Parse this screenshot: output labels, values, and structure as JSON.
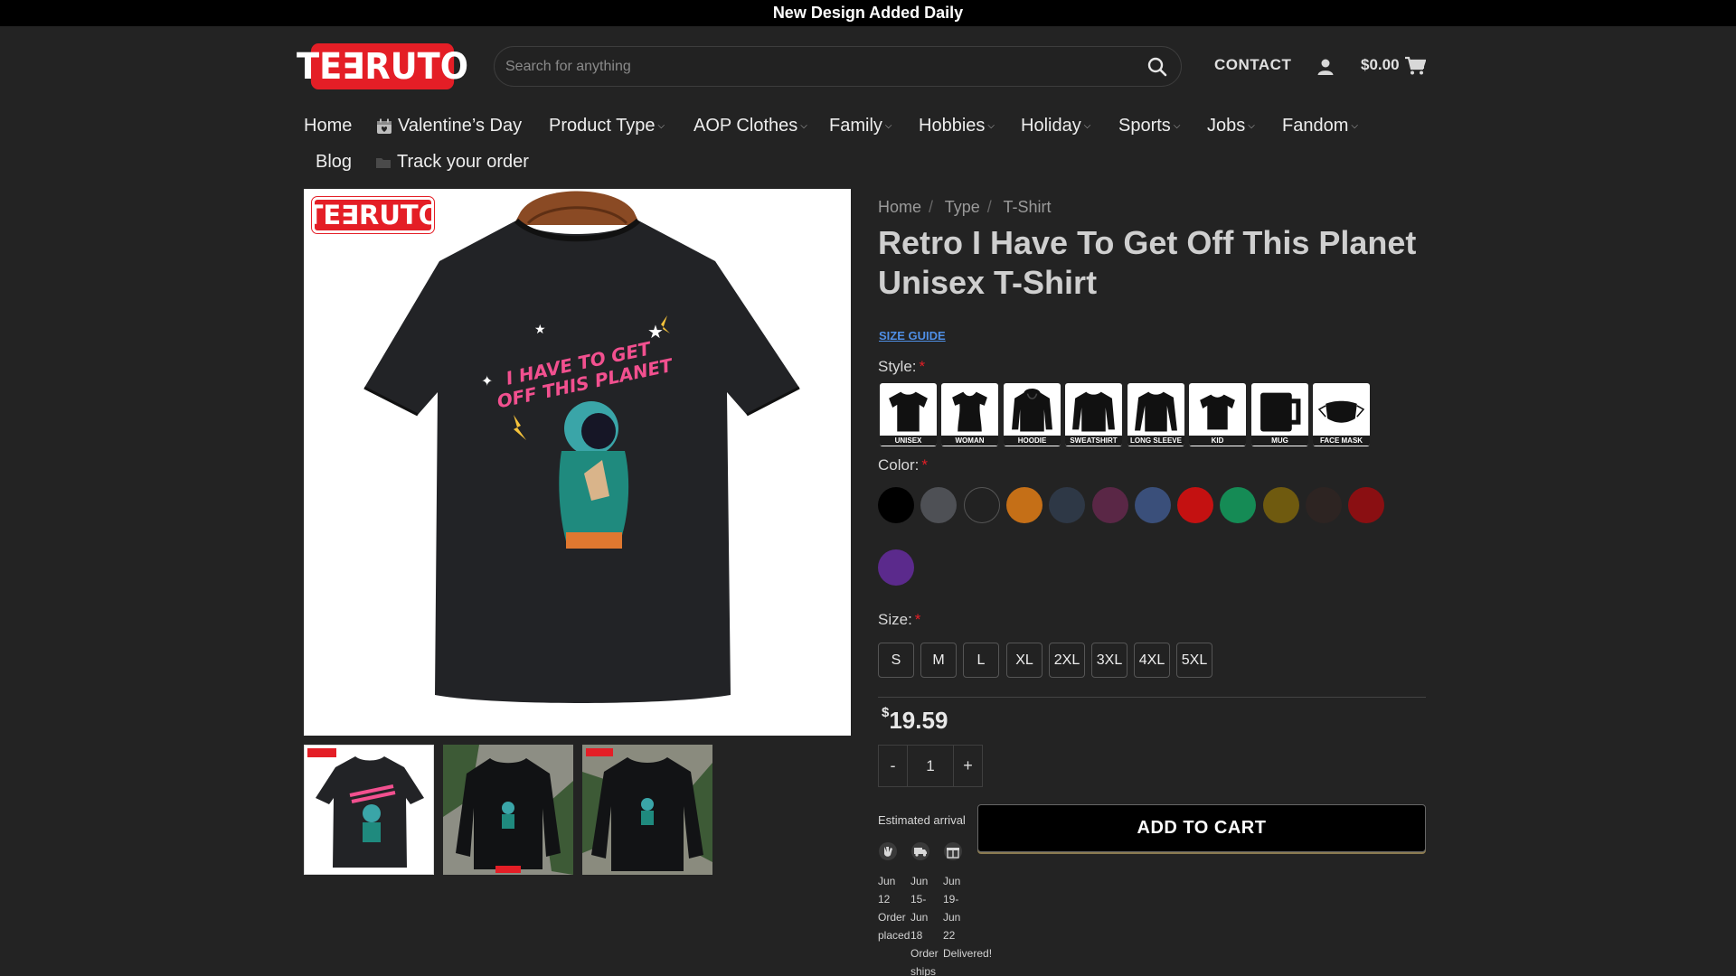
{
  "topbar": {
    "text": "New Design Added Daily"
  },
  "header": {
    "logo_text": "TE∃RUTO",
    "search_placeholder": "Search for anything",
    "contact_label": "CONTACT",
    "cart_amount": "$0.00"
  },
  "nav": {
    "items": [
      {
        "label": "Home",
        "chevron": false
      },
      {
        "label": "Valentine’s Day",
        "chevron": false,
        "icon": "calendar-icon"
      },
      {
        "label": "Product Type",
        "chevron": true
      },
      {
        "label": "AOP Clothes",
        "chevron": true
      },
      {
        "label": "Family",
        "chevron": true
      },
      {
        "label": "Hobbies",
        "chevron": true
      },
      {
        "label": "Holiday",
        "chevron": true
      },
      {
        "label": "Sports",
        "chevron": true
      },
      {
        "label": "Jobs",
        "chevron": true
      },
      {
        "label": "Fandom",
        "chevron": true
      },
      {
        "label": "Blog",
        "chevron": false
      },
      {
        "label": "Track your order",
        "chevron": false,
        "icon": "folder-icon"
      }
    ]
  },
  "gallery": {
    "logo_text": "TE∃RUTO",
    "design_text_line1": "I HAVE TO GET",
    "design_text_line2": "OFF THIS PLANET"
  },
  "product": {
    "breadcrumb": [
      "Home",
      "Type",
      "T-Shirt"
    ],
    "title": "Retro I Have To Get Off This Planet Unisex T-Shirt",
    "size_guide": "SIZE GUIDE",
    "style_label": "Style:",
    "color_label": "Color:",
    "size_label": "Size:",
    "required_mark": "*",
    "styles": [
      "UNISEX",
      "WOMAN",
      "HOODIE",
      "SWEATSHIRT",
      "LONG SLEEVE",
      "KID",
      "MUG",
      "FACE MASK"
    ],
    "colors": [
      "#000000",
      "#4e5055",
      "#222222",
      "#c56f17",
      "#2e3846",
      "#5a2746",
      "#3a4f7a",
      "#c41111",
      "#158b55",
      "#6f5a0f",
      "#2d2422",
      "#8a0f12",
      "#5b2a8c"
    ],
    "sizes": [
      "S",
      "M",
      "L",
      "XL",
      "2XL",
      "3XL",
      "4XL",
      "5XL"
    ],
    "price_currency": "$",
    "price_value": "19.59",
    "quantity": "1",
    "qty_minus": "-",
    "qty_plus": "+",
    "add_to_cart": "ADD TO CART",
    "estimated_arrival": "Estimated arrival",
    "arrival_steps": [
      {
        "date": "Jun 12",
        "label": "Order placed",
        "icon": "hand-icon"
      },
      {
        "date": "Jun 15- Jun 18",
        "label": "Order ships",
        "icon": "truck-icon"
      },
      {
        "date": "Jun 19- Jun 22",
        "label": "Delivered!",
        "icon": "gift-icon"
      }
    ]
  }
}
